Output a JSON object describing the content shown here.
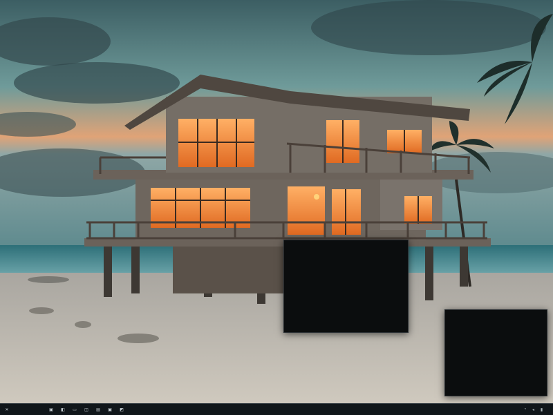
{
  "desktop": {
    "wallpaper": "stilt-beach-house-at-dusk",
    "colors": {
      "sky": "#5f8a8c",
      "sunset": "#e59a63",
      "sea": "#3f8c95",
      "sand": "#c9c3b8",
      "window_glow": "#ff8b3a"
    }
  },
  "windows": [
    {
      "id": "term-1",
      "title": "",
      "lines": [
        "",
        "",
        "",
        "",
        "",
        "",
        "",
        "",
        "",
        "",
        "",
        "",
        "",
        "",
        "",
        "",
        ""
      ]
    },
    {
      "id": "term-2",
      "title": "",
      "lines": [
        "",
        "",
        "",
        "",
        "",
        "",
        "",
        "",
        "",
        "",
        "",
        "",
        "",
        "",
        ""
      ]
    }
  ],
  "taskbar": {
    "labels": [
      "",
      "",
      ""
    ],
    "apps": [
      {
        "name": "app-icon-1",
        "glyph": "▣"
      },
      {
        "name": "app-icon-2",
        "glyph": "◧"
      },
      {
        "name": "app-icon-3",
        "glyph": "▭"
      },
      {
        "name": "app-icon-4",
        "glyph": "◫"
      },
      {
        "name": "app-icon-5",
        "glyph": "▤"
      },
      {
        "name": "app-icon-6",
        "glyph": "▣"
      },
      {
        "name": "app-icon-7",
        "glyph": "◩"
      }
    ],
    "tray": [
      {
        "name": "network-icon",
        "glyph": "◔"
      },
      {
        "name": "volume-icon",
        "glyph": "◂"
      },
      {
        "name": "battery-icon",
        "glyph": "▮"
      }
    ],
    "clock": {
      "time": "",
      "date": ""
    }
  }
}
